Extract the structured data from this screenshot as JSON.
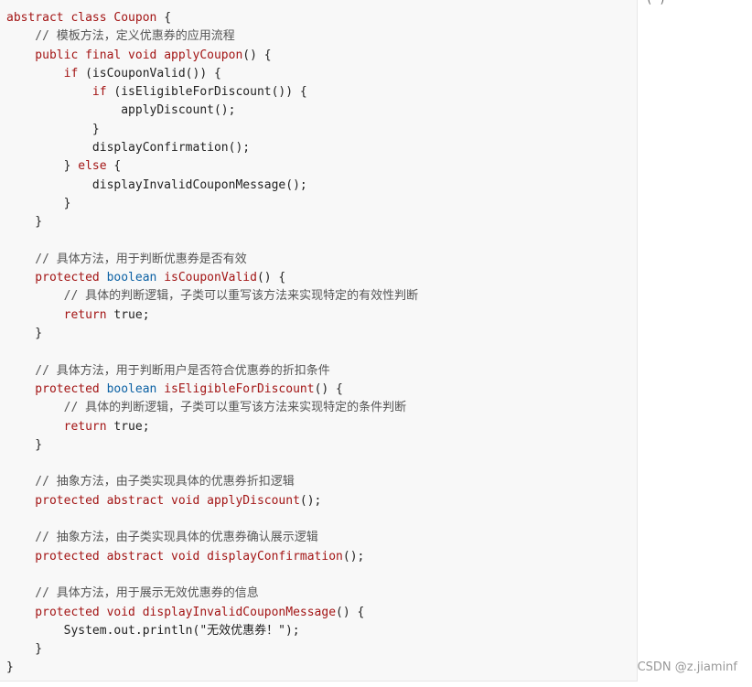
{
  "watermark": "CSDN @z.jiaminf",
  "corner_glyph": "( )",
  "code_lines": [
    [
      {
        "t": "abstract class ",
        "c": "kw"
      },
      {
        "t": "Coupon",
        "c": "fn"
      },
      {
        "t": " {",
        "c": "plain"
      }
    ],
    [
      {
        "t": "    // 模板方法，定义优惠券的应用流程",
        "c": "comment"
      }
    ],
    [
      {
        "t": "    public final void ",
        "c": "kw"
      },
      {
        "t": "applyCoupon",
        "c": "fn"
      },
      {
        "t": "() {",
        "c": "plain"
      }
    ],
    [
      {
        "t": "        if",
        "c": "kw"
      },
      {
        "t": " (isCouponValid()) {",
        "c": "plain"
      }
    ],
    [
      {
        "t": "            if",
        "c": "kw"
      },
      {
        "t": " (isEligibleForDiscount()) {",
        "c": "plain"
      }
    ],
    [
      {
        "t": "                applyDiscount();",
        "c": "plain"
      }
    ],
    [
      {
        "t": "            }",
        "c": "plain"
      }
    ],
    [
      {
        "t": "            displayConfirmation();",
        "c": "plain"
      }
    ],
    [
      {
        "t": "        } ",
        "c": "plain"
      },
      {
        "t": "else",
        "c": "kw"
      },
      {
        "t": " {",
        "c": "plain"
      }
    ],
    [
      {
        "t": "            displayInvalidCouponMessage();",
        "c": "plain"
      }
    ],
    [
      {
        "t": "        }",
        "c": "plain"
      }
    ],
    [
      {
        "t": "    }",
        "c": "plain"
      }
    ],
    [
      {
        "t": "",
        "c": "plain"
      }
    ],
    [
      {
        "t": "    // 具体方法，用于判断优惠券是否有效",
        "c": "comment"
      }
    ],
    [
      {
        "t": "    protected ",
        "c": "kw"
      },
      {
        "t": "boolean ",
        "c": "type"
      },
      {
        "t": "isCouponValid",
        "c": "fn"
      },
      {
        "t": "() {",
        "c": "plain"
      }
    ],
    [
      {
        "t": "        // 具体的判断逻辑，子类可以重写该方法来实现特定的有效性判断",
        "c": "comment"
      }
    ],
    [
      {
        "t": "        return ",
        "c": "kw"
      },
      {
        "t": "true;",
        "c": "plain"
      }
    ],
    [
      {
        "t": "    }",
        "c": "plain"
      }
    ],
    [
      {
        "t": "",
        "c": "plain"
      }
    ],
    [
      {
        "t": "    // 具体方法，用于判断用户是否符合优惠券的折扣条件",
        "c": "comment"
      }
    ],
    [
      {
        "t": "    protected ",
        "c": "kw"
      },
      {
        "t": "boolean ",
        "c": "type"
      },
      {
        "t": "isEligibleForDiscount",
        "c": "fn"
      },
      {
        "t": "() {",
        "c": "plain"
      }
    ],
    [
      {
        "t": "        // 具体的判断逻辑，子类可以重写该方法来实现特定的条件判断",
        "c": "comment"
      }
    ],
    [
      {
        "t": "        return ",
        "c": "kw"
      },
      {
        "t": "true;",
        "c": "plain"
      }
    ],
    [
      {
        "t": "    }",
        "c": "plain"
      }
    ],
    [
      {
        "t": "",
        "c": "plain"
      }
    ],
    [
      {
        "t": "    // 抽象方法，由子类实现具体的优惠券折扣逻辑",
        "c": "comment"
      }
    ],
    [
      {
        "t": "    protected abstract void ",
        "c": "kw"
      },
      {
        "t": "applyDiscount",
        "c": "fn"
      },
      {
        "t": "();",
        "c": "plain"
      }
    ],
    [
      {
        "t": "",
        "c": "plain"
      }
    ],
    [
      {
        "t": "    // 抽象方法，由子类实现具体的优惠券确认展示逻辑",
        "c": "comment"
      }
    ],
    [
      {
        "t": "    protected abstract void ",
        "c": "kw"
      },
      {
        "t": "displayConfirmation",
        "c": "fn"
      },
      {
        "t": "();",
        "c": "plain"
      }
    ],
    [
      {
        "t": "",
        "c": "plain"
      }
    ],
    [
      {
        "t": "    // 具体方法，用于展示无效优惠券的信息",
        "c": "comment"
      }
    ],
    [
      {
        "t": "    protected void ",
        "c": "kw"
      },
      {
        "t": "displayInvalidCouponMessage",
        "c": "fn"
      },
      {
        "t": "() {",
        "c": "plain"
      }
    ],
    [
      {
        "t": "        System.out.println(",
        "c": "plain"
      },
      {
        "t": "\"无效优惠券！\"",
        "c": "plain"
      },
      {
        "t": ");",
        "c": "plain"
      }
    ],
    [
      {
        "t": "    }",
        "c": "plain"
      }
    ],
    [
      {
        "t": "}",
        "c": "plain"
      }
    ]
  ]
}
